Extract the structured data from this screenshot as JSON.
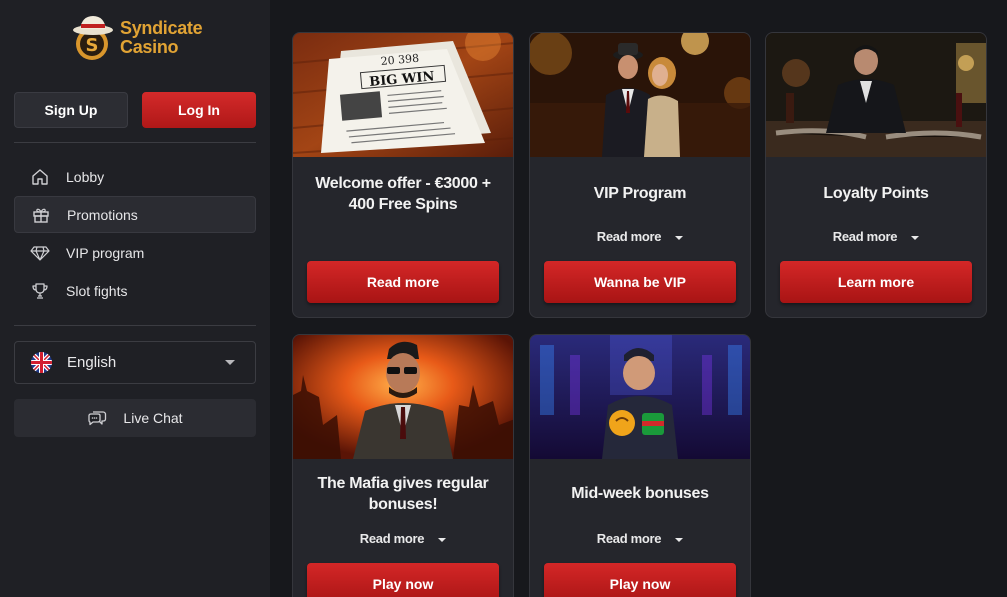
{
  "brand": {
    "line1": "Syndicate",
    "line2": "Casino",
    "logo_letter": "S"
  },
  "auth": {
    "signup": "Sign Up",
    "login": "Log In"
  },
  "nav": [
    {
      "label": "Lobby",
      "icon": "home-icon"
    },
    {
      "label": "Promotions",
      "icon": "gift-icon",
      "active": true
    },
    {
      "label": "VIP program",
      "icon": "diamond-icon"
    },
    {
      "label": "Slot fights",
      "icon": "trophy-icon"
    }
  ],
  "language": {
    "label": "English"
  },
  "chat": {
    "label": "Live Chat"
  },
  "promos": [
    {
      "title": "Welcome offer - €3000 + 400 Free Spins",
      "button": "Read more",
      "newspaper_number": "20 398",
      "newspaper_headline": "BIG WIN"
    },
    {
      "title": "VIP Program",
      "read_more": "Read more",
      "button": "Wanna be VIP"
    },
    {
      "title": "Loyalty Points",
      "read_more": "Read more",
      "button": "Learn more"
    },
    {
      "title": "The Mafia gives regular bonuses!",
      "read_more": "Read more",
      "button": "Play now"
    },
    {
      "title": "Mid-week bonuses",
      "read_more": "Read more",
      "button": "Play now"
    }
  ],
  "colors": {
    "accent": "#c81e1e",
    "logo": "#e1a334",
    "background": "#17181c",
    "sidebar": "#1f2025",
    "card": "#25262c"
  }
}
